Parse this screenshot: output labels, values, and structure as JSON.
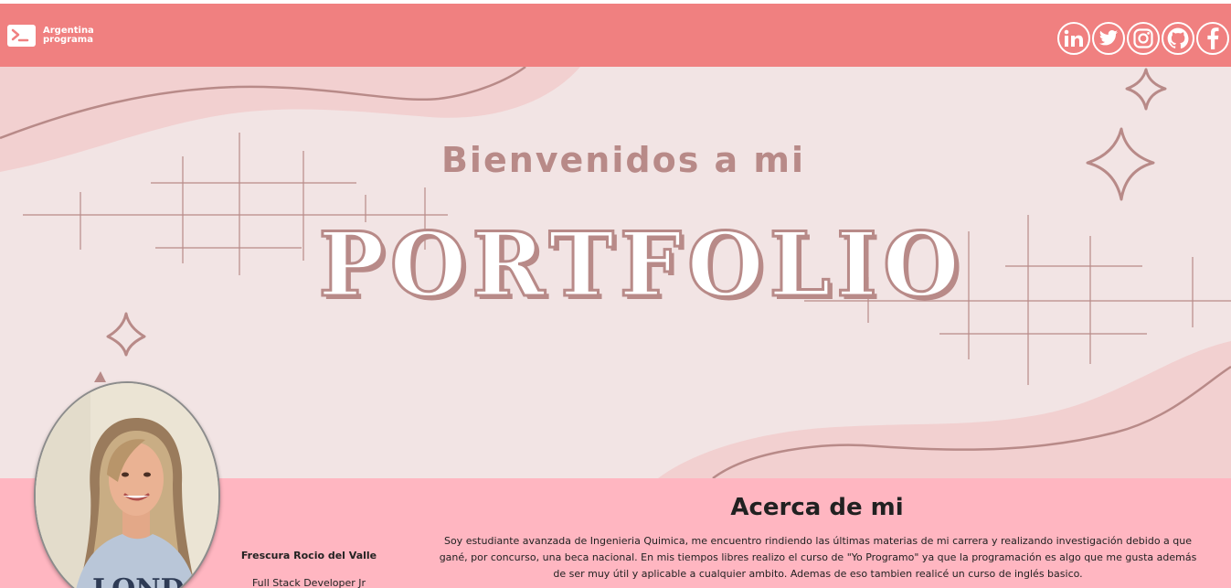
{
  "navbar": {
    "logo_line1": "Argentina",
    "logo_line2": "programa",
    "logo_icon": "terminal-icon",
    "background": "#f08080",
    "socials": [
      {
        "name": "linkedin",
        "icon": "linkedin-icon"
      },
      {
        "name": "twitter",
        "icon": "twitter-icon"
      },
      {
        "name": "instagram",
        "icon": "instagram-icon"
      },
      {
        "name": "github",
        "icon": "github-icon"
      },
      {
        "name": "facebook",
        "icon": "facebook-icon"
      }
    ]
  },
  "hero": {
    "subtitle": "Bienvenidos a mi",
    "title": "PORTFOLIO",
    "background": "#f2e4e4",
    "accent": "#b88a88"
  },
  "profile": {
    "name": "Frescura Rocio del Valle",
    "role": "Full Stack Developer Jr",
    "shirt_text": "LONDO"
  },
  "about": {
    "title": "Acerca de mi",
    "text": "Soy estudiante avanzada de Ingenieria Quimica, me encuentro rindiendo las últimas materias de mi carrera y realizando investigación debido a que gané, por concurso, una beca nacional. En mis tiempos libres realizo el curso de \"Yo Programo\" ya que la programación es algo que me gusta además de ser muy útil y aplicable a cualquier ambito. Ademas de eso tambien realicé un curso de inglés basico.",
    "background": "#ffb6c1"
  }
}
